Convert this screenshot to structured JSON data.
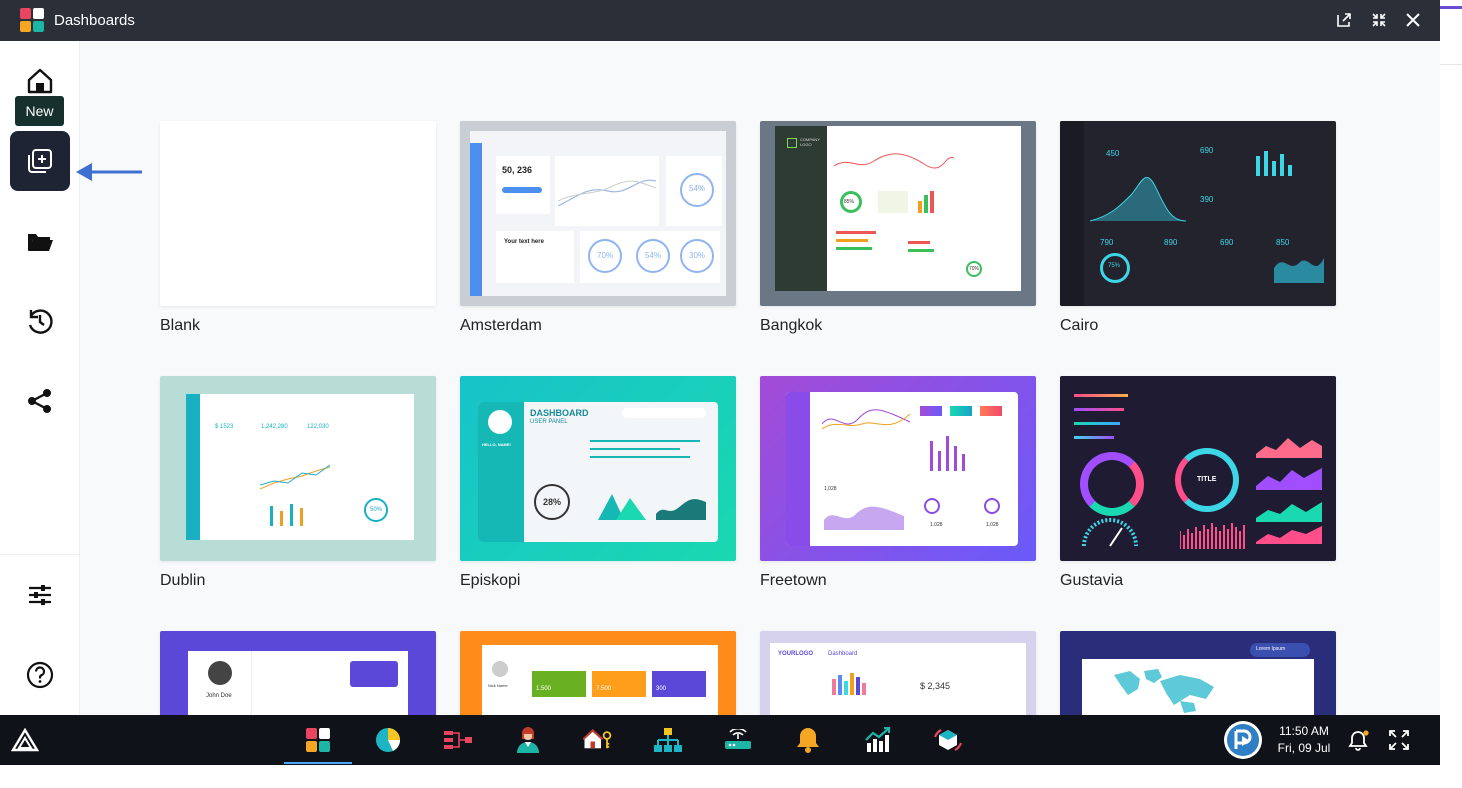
{
  "window": {
    "title": "Dashboards"
  },
  "sidebar": {
    "tooltip": "New",
    "items": [
      {
        "name": "home",
        "icon": "home-icon"
      },
      {
        "name": "new",
        "icon": "new-icon",
        "active": true
      },
      {
        "name": "open",
        "icon": "folder-icon"
      },
      {
        "name": "recent",
        "icon": "history-icon"
      },
      {
        "name": "share",
        "icon": "share-icon"
      },
      {
        "name": "settings",
        "icon": "sliders-icon"
      },
      {
        "name": "help",
        "icon": "help-icon"
      }
    ]
  },
  "templates": [
    {
      "label": "Blank"
    },
    {
      "label": "Amsterdam"
    },
    {
      "label": "Bangkok"
    },
    {
      "label": "Cairo"
    },
    {
      "label": "Dublin"
    },
    {
      "label": "Episkopi"
    },
    {
      "label": "Freetown"
    },
    {
      "label": "Gustavia"
    },
    {
      "label": ""
    },
    {
      "label": ""
    },
    {
      "label": ""
    },
    {
      "label": ""
    }
  ],
  "thumbs": {
    "amsterdam": {
      "big_number": "50, 236",
      "heading": "Your text here",
      "pct1": "54%",
      "pct2": "70%",
      "pct3": "54%",
      "pct4": "30%"
    },
    "bangkok": {
      "company": "COMPANY LOGO",
      "pct": "85%",
      "pct2": "70%"
    },
    "cairo": {
      "n1": "450",
      "n2": "690",
      "n3": "390",
      "n4": "790",
      "n5": "890",
      "n6": "690",
      "n7": "850",
      "pct": "75%"
    },
    "dublin": {
      "v1": "$ 1523",
      "v2": "1,242,280",
      "v3": "122,030",
      "pct": "50%"
    },
    "episkopi": {
      "title": "DASHBOARD",
      "subtitle": "USER PANEL",
      "hello": "HELLO, NAME!",
      "pct": "28%"
    },
    "freetown": {
      "v1": "1.028",
      "v2": "1,028",
      "v3": "1,028"
    },
    "gustavia": {
      "center": "TITLE"
    },
    "row3_a": {
      "name": "John Doe"
    },
    "row3_b": {
      "v1": "1.500",
      "v2": "7.500",
      "v3": "300",
      "name": "Nick Name"
    },
    "row3_c": {
      "logo": "YOURLOGO",
      "title": "Dashboard",
      "value": "$ 2,345"
    },
    "row3_d": {
      "name": "Lorem Ipsum"
    }
  },
  "taskbar": {
    "apps": [
      {
        "name": "dashboards",
        "icon": "dashboards-icon"
      },
      {
        "name": "reports",
        "icon": "pie-chart-icon"
      },
      {
        "name": "dataflow",
        "icon": "dataflow-icon"
      },
      {
        "name": "users",
        "icon": "user-icon"
      },
      {
        "name": "home-access",
        "icon": "home-key-icon"
      },
      {
        "name": "hierarchy",
        "icon": "hierarchy-icon"
      },
      {
        "name": "router",
        "icon": "router-icon"
      },
      {
        "name": "alerts",
        "icon": "bell-icon"
      },
      {
        "name": "analytics",
        "icon": "growth-chart-icon"
      },
      {
        "name": "sync",
        "icon": "sync-box-icon"
      }
    ],
    "time": "11:50 AM",
    "date": "Fri, 09 Jul"
  },
  "colors": {
    "titlebar": "#2a2f38",
    "taskbar": "#0f1219",
    "active": "#1e2433",
    "arrow": "#3f6fd1"
  }
}
